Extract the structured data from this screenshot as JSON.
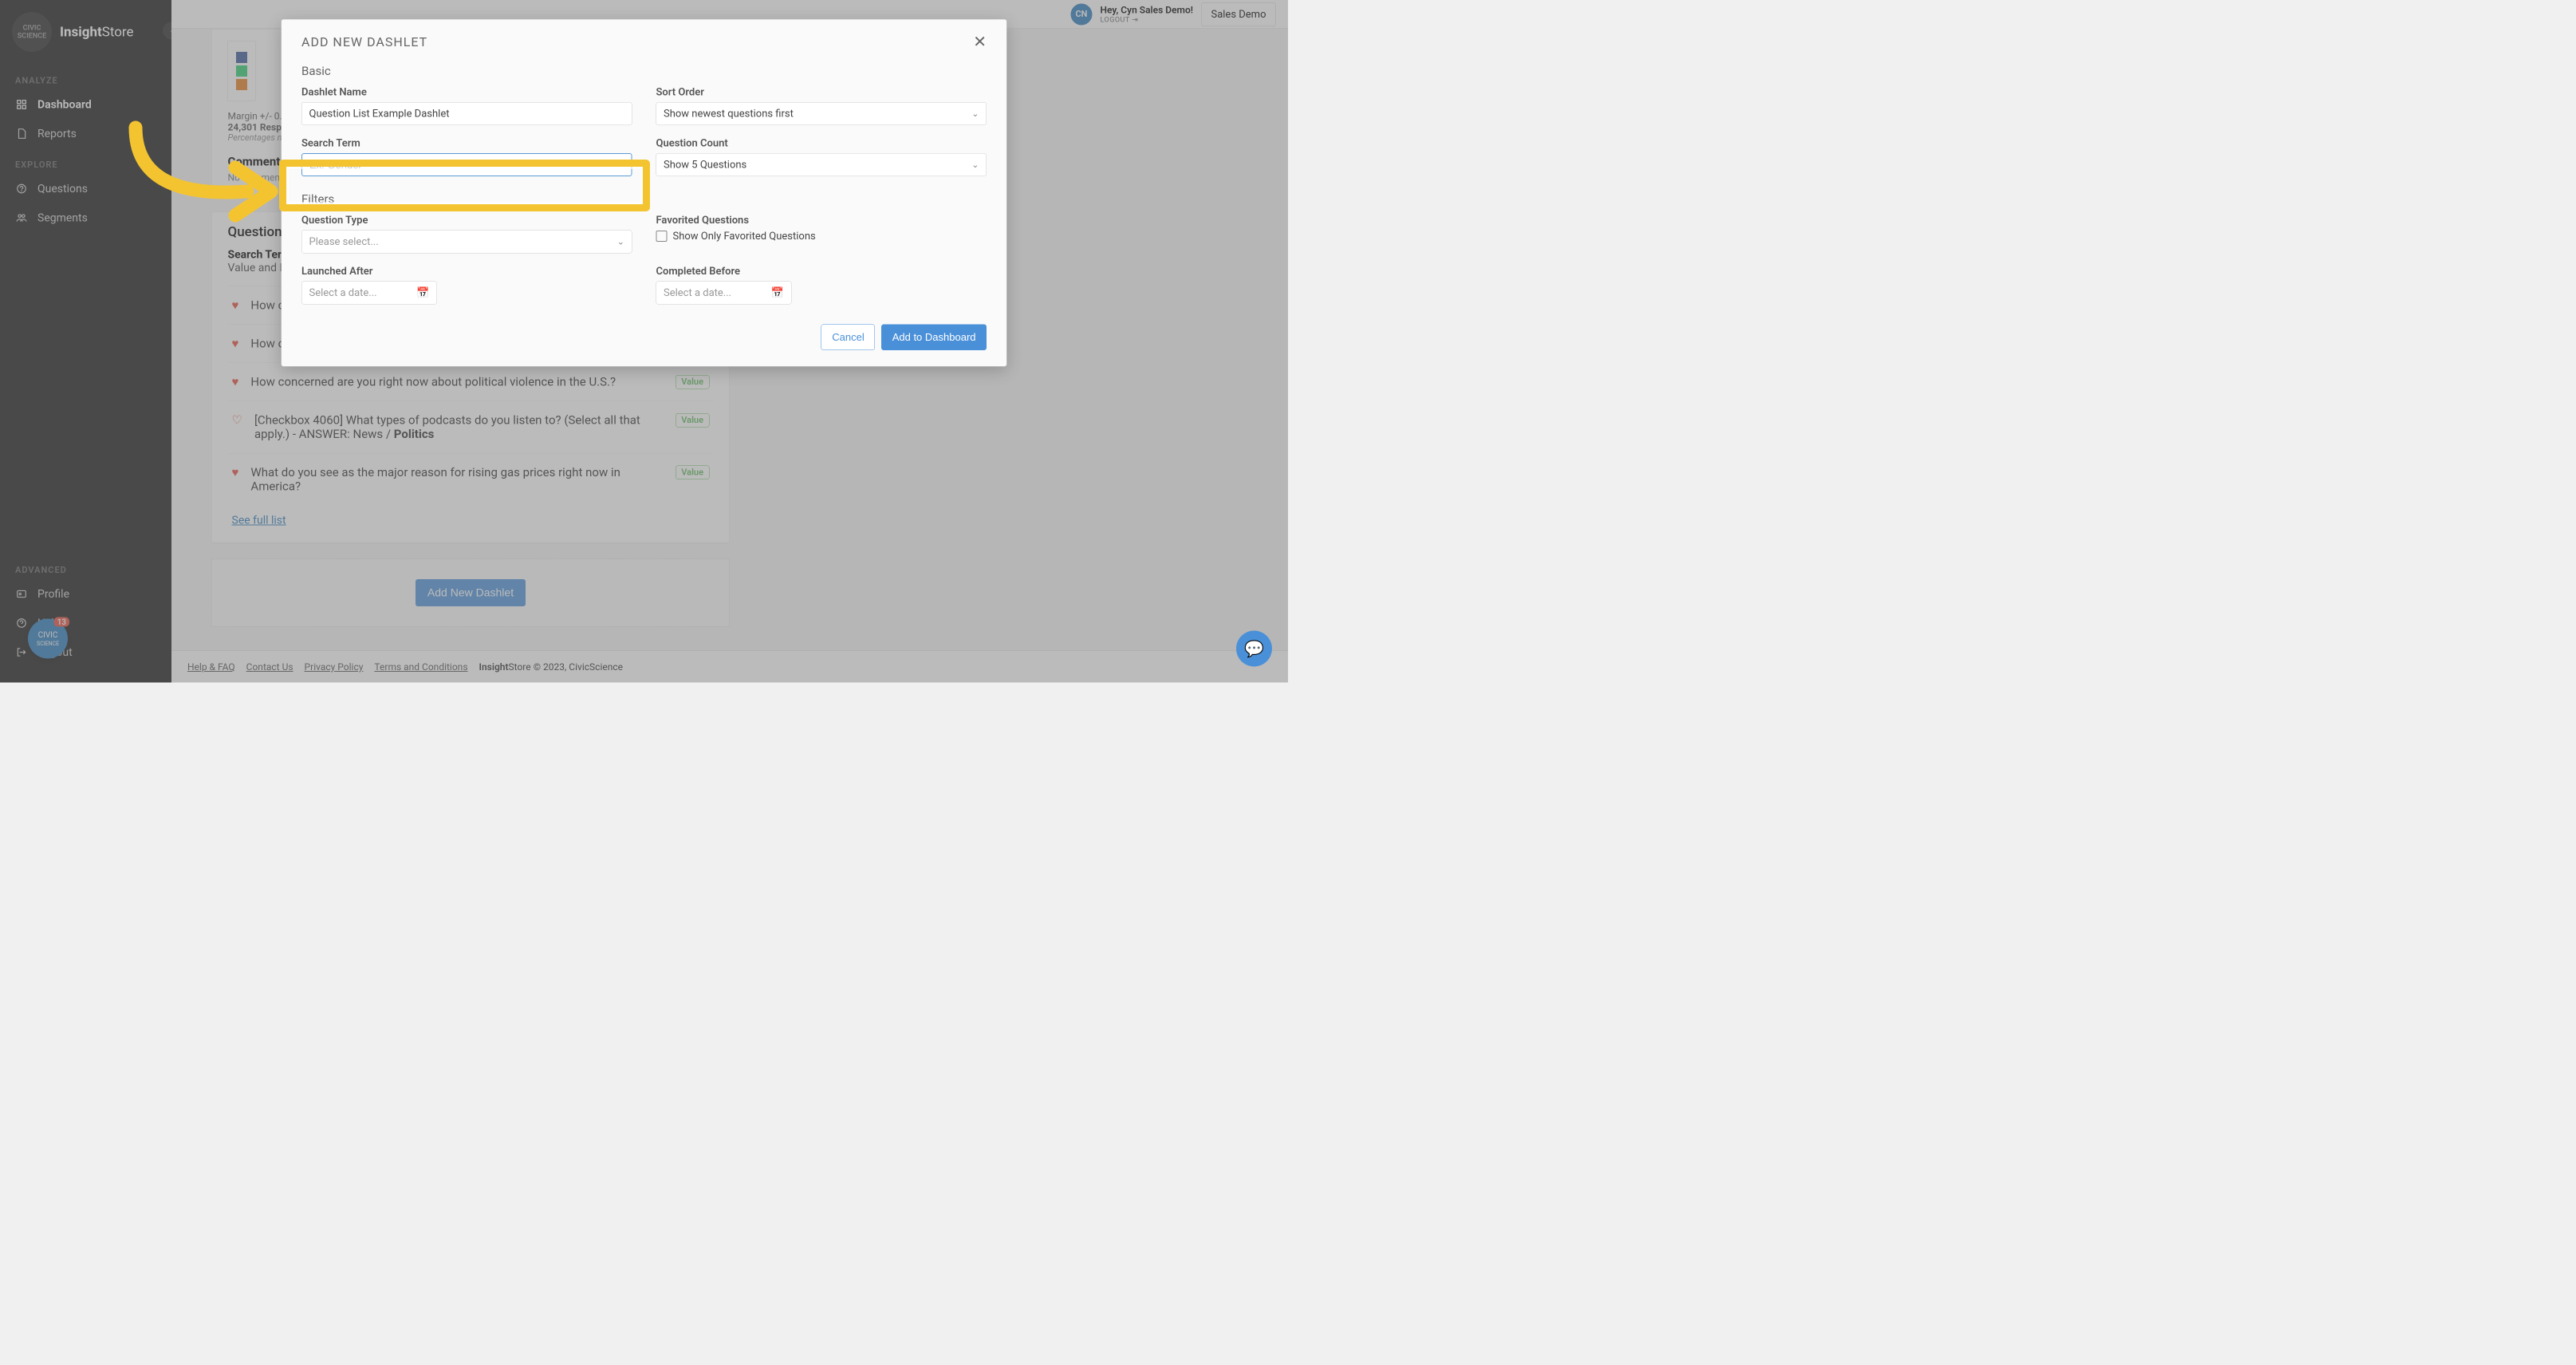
{
  "brand": {
    "logo_line1": "CIVIC",
    "logo_line2": "SCIENCE",
    "name_prefix": "Insight",
    "name_suffix": "Store"
  },
  "sidebar": {
    "sections": {
      "analyze": "ANALYZE",
      "explore": "EXPLORE",
      "advanced": "ADVANCED"
    },
    "items": {
      "dashboard": "Dashboard",
      "reports": "Reports",
      "questions": "Questions",
      "segments": "Segments",
      "profile": "Profile",
      "help": "Help",
      "logout": "Logout"
    },
    "chat_badge": "13"
  },
  "topbar": {
    "avatar": "CN",
    "greeting": "Hey, Cyn Sales Demo!",
    "logout": "LOGOUT",
    "demo_btn": "Sales Demo"
  },
  "stats": {
    "margin": "Margin +/- 0.6",
    "responses": "24,301 Responses",
    "note": "Percentages may not total 100 due to rounding"
  },
  "comments": {
    "title": "Comments",
    "subtitle": "No comments provided"
  },
  "ql": {
    "title": "Question List Example Dashlet",
    "search_label": "Search Term",
    "search_value": "Value and Politics",
    "rows": [
      {
        "fav": true,
        "text": "How concerned are you...",
        "tag": ""
      },
      {
        "fav": true,
        "text": "How concerned are you right now about political...",
        "tag": ""
      },
      {
        "fav": true,
        "text": "How concerned are you right now about political violence in the U.S.?",
        "tag": "Value"
      },
      {
        "fav": false,
        "text_before": "[Checkbox 4060] What types of podcasts do you listen to? (Select all that apply.) - ANSWER: News / ",
        "hl": "Politics",
        "tag": "Value"
      },
      {
        "fav": true,
        "text": "What do you see as the major reason for rising gas prices right now in America?",
        "tag": "Value"
      }
    ],
    "see_full": "See full list",
    "add_btn": "Add New Dashlet"
  },
  "footer": {
    "help": "Help & FAQ",
    "contact": "Contact Us",
    "privacy": "Privacy Policy",
    "terms": "Terms and Conditions",
    "copy_prefix": "Insight",
    "copy_suffix": "Store",
    "copy_rest": " © 2023, CivicScience"
  },
  "modal": {
    "title": "ADD NEW DASHLET",
    "basic": "Basic",
    "filters": "Filters",
    "dashlet_name_label": "Dashlet Name",
    "dashlet_name_value": "Question List Example Dashlet",
    "sort_order_label": "Sort Order",
    "sort_order_value": "Show newest questions first",
    "search_term_label": "Search Term",
    "search_term_placeholder": "Ex. Gender",
    "question_count_label": "Question Count",
    "question_count_value": "Show 5 Questions",
    "question_type_label": "Question Type",
    "question_type_value": "Please select...",
    "favorited_label": "Favorited Questions",
    "favorited_checkbox": "Show Only Favorited Questions",
    "launched_after_label": "Launched After",
    "launched_after_value": "Select a date...",
    "completed_before_label": "Completed Before",
    "completed_before_value": "Select a date...",
    "cancel": "Cancel",
    "submit": "Add to Dashboard"
  }
}
